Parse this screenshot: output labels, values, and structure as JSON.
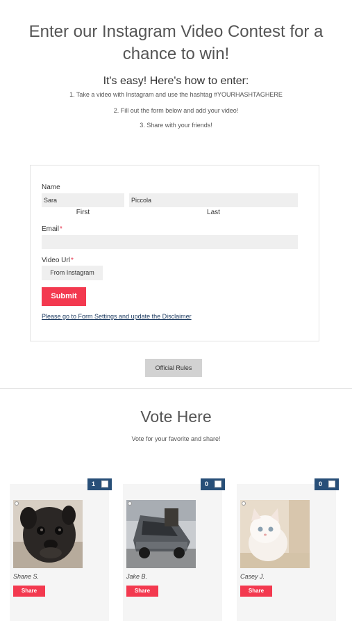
{
  "header": {
    "title": "Enter our Instagram Video Contest for a chance to win!",
    "subtitle": "It's easy! Here's how to enter:",
    "steps": [
      "1. Take a video with Instagram and use the hashtag #YOURHASHTAGHERE",
      "2. Fill out the form below and add your video!",
      "3. Share with your friends!"
    ]
  },
  "form": {
    "name_label": "Name",
    "first_value": "Sara",
    "last_value": "Piccola",
    "first_sublabel": "First",
    "last_sublabel": "Last",
    "email_label": "Email",
    "email_value": "",
    "required_mark": "*",
    "video_label": "Video Url",
    "from_instagram_label": "From Instagram",
    "submit_label": "Submit",
    "disclaimer_link": "Please go to Form Settings and update the Disclaimer"
  },
  "rules": {
    "button_label": "Official Rules"
  },
  "vote": {
    "title": "Vote Here",
    "subtitle": "Vote for your favorite and share!",
    "entries": [
      {
        "name": "Shane S.",
        "votes": "1",
        "share_label": "Share",
        "thumb": "pug-photo"
      },
      {
        "name": "Jake B.",
        "votes": "0",
        "share_label": "Share",
        "thumb": "car-photo"
      },
      {
        "name": "Casey J.",
        "votes": "0",
        "share_label": "Share",
        "thumb": "kitten-photo"
      }
    ]
  },
  "colors": {
    "accent": "#f3394f",
    "badge": "#284f78",
    "link": "#1c3a60"
  }
}
